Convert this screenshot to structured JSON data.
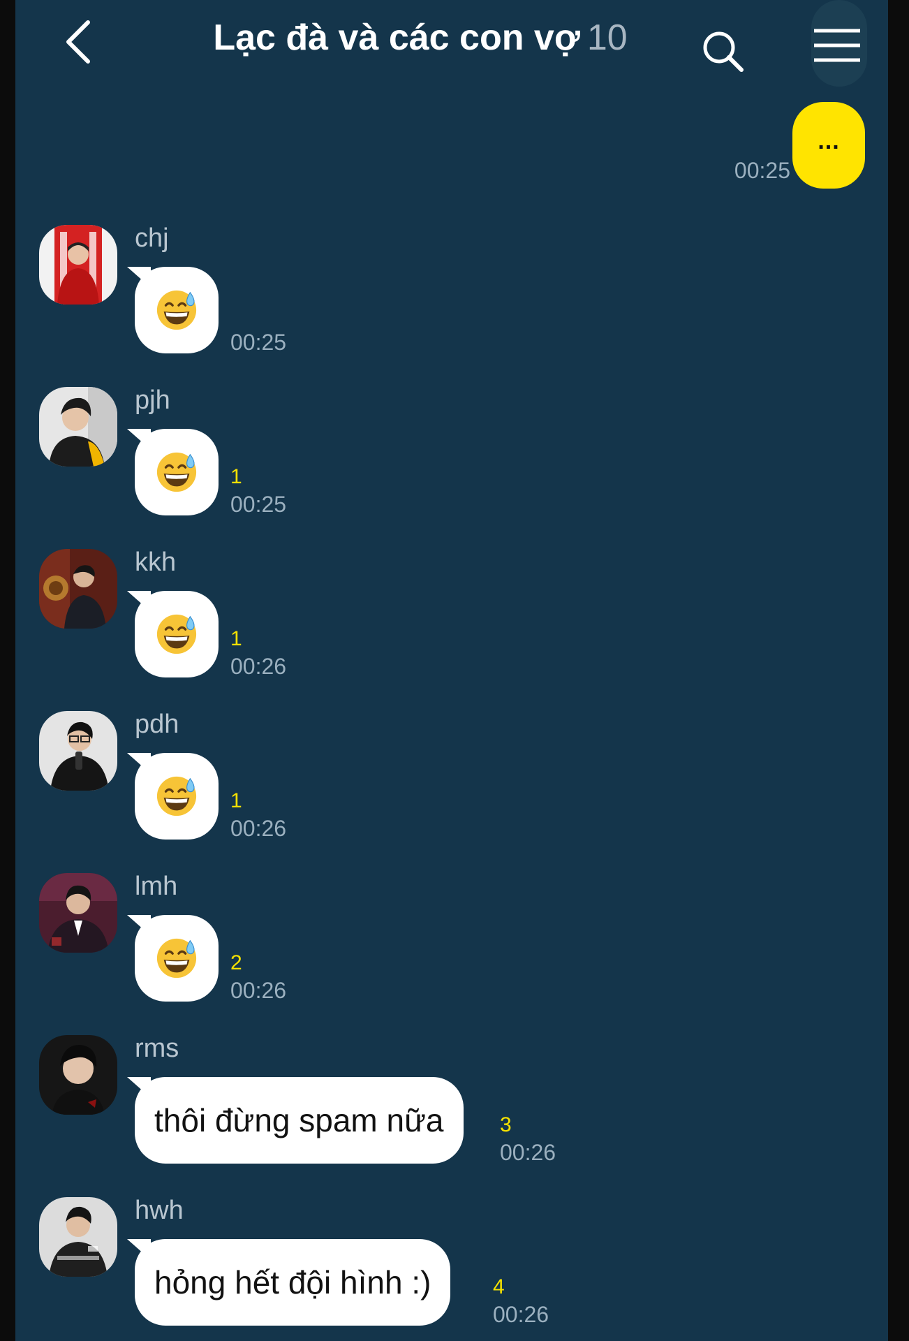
{
  "header": {
    "title": "Lạc đà và các con vợ",
    "member_count": "10"
  },
  "icons": {
    "back": "chevron-left-icon",
    "search": "search-icon",
    "menu": "hamburger-menu-icon"
  },
  "colors": {
    "background": "#14354b",
    "my_bubble": "#ffe400",
    "other_bubble": "#ffffff",
    "unread_count": "#f5e100",
    "timestamp": "#9bb0bf"
  },
  "my_message": {
    "text": "...",
    "time": "00:25"
  },
  "messages": [
    {
      "sender": "chj",
      "content": "😅",
      "unread": "",
      "time": "00:25"
    },
    {
      "sender": "pjh",
      "content": "😅",
      "unread": "1",
      "time": "00:25"
    },
    {
      "sender": "kkh",
      "content": "😅",
      "unread": "1",
      "time": "00:26"
    },
    {
      "sender": "pdh",
      "content": "😅",
      "unread": "1",
      "time": "00:26"
    },
    {
      "sender": "lmh",
      "content": "😅",
      "unread": "2",
      "time": "00:26"
    },
    {
      "sender": "rms",
      "content": "thôi đừng spam nữa",
      "unread": "3",
      "time": "00:26"
    },
    {
      "sender": "hwh",
      "content": "hỏng hết đội hình :)",
      "unread": "4",
      "time": "00:26"
    }
  ]
}
